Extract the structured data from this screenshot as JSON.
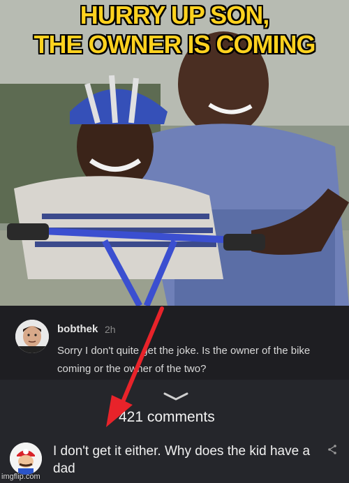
{
  "meme": {
    "caption_line1": "HURRY UP SON,",
    "caption_line2": "THE OWNER IS COMING"
  },
  "comment": {
    "username": "bobthek",
    "timestamp": "2h",
    "text": "Sorry I don't quite get the joke. Is the owner of the bike coming or the owner of the two?"
  },
  "thread": {
    "count_label": "421 comments",
    "reply_text": "I don't get it either. Why does the kid have a dad"
  },
  "watermark": "imgflip.com",
  "colors": {
    "caption": "#ffd21f",
    "arrow": "#e8232a",
    "panel_dark": "#1e1e22"
  }
}
